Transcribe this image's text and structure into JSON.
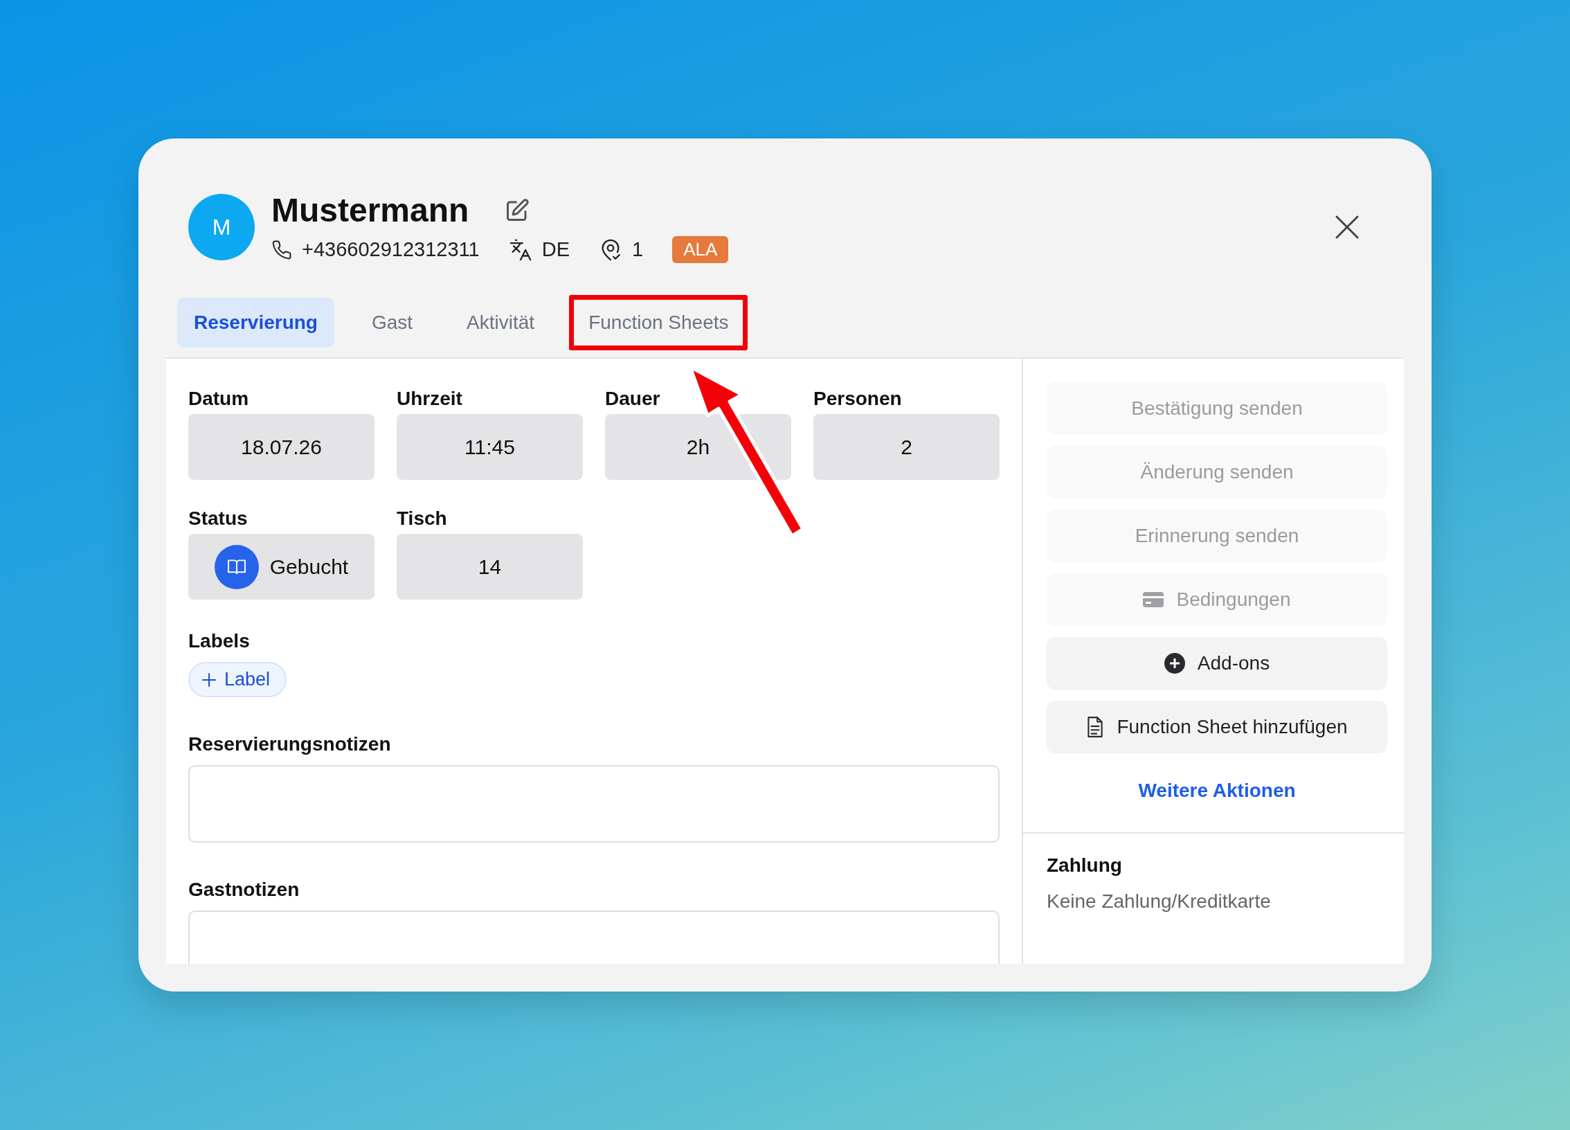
{
  "guest": {
    "initial": "M",
    "name": "Mustermann",
    "phone": "+436602912312311",
    "language": "DE",
    "visits": "1",
    "tag": "ALA"
  },
  "tabs": [
    {
      "label": "Reservierung",
      "selected": true,
      "highlighted": false
    },
    {
      "label": "Gast",
      "selected": false,
      "highlighted": false
    },
    {
      "label": "Aktivität",
      "selected": false,
      "highlighted": false
    },
    {
      "label": "Function Sheets",
      "selected": false,
      "highlighted": true
    }
  ],
  "fields": [
    {
      "label": "Datum",
      "value": "18.07.26",
      "kind": "plain"
    },
    {
      "label": "Uhrzeit",
      "value": "11:45",
      "kind": "plain"
    },
    {
      "label": "Dauer",
      "value": "2h",
      "kind": "plain"
    },
    {
      "label": "Personen",
      "value": "2",
      "kind": "plain"
    },
    {
      "label": "Status",
      "value": "Gebucht",
      "kind": "status"
    },
    {
      "label": "Tisch",
      "value": "14",
      "kind": "plain"
    }
  ],
  "labels": {
    "title": "Labels",
    "add_button": "Label"
  },
  "notes": [
    {
      "label": "Reservierungsnotizen"
    },
    {
      "label": "Gastnotizen"
    }
  ],
  "actions": [
    {
      "label": "Bestätigung senden",
      "disabled": true,
      "kind": "text"
    },
    {
      "label": "Änderung senden",
      "disabled": true,
      "kind": "text"
    },
    {
      "label": "Erinnerung senden",
      "disabled": true,
      "kind": "text"
    },
    {
      "label": "Bedingungen",
      "disabled": true,
      "kind": "card"
    },
    {
      "label": "Add-ons",
      "disabled": false,
      "kind": "plus"
    },
    {
      "label": "Function Sheet hinzufügen",
      "disabled": false,
      "kind": "document"
    }
  ],
  "more_actions": "Weitere Aktionen",
  "payment": {
    "title": "Zahlung",
    "text": "Keine Zahlung/Kreditkarte"
  },
  "annotation": {
    "arrow": true
  }
}
